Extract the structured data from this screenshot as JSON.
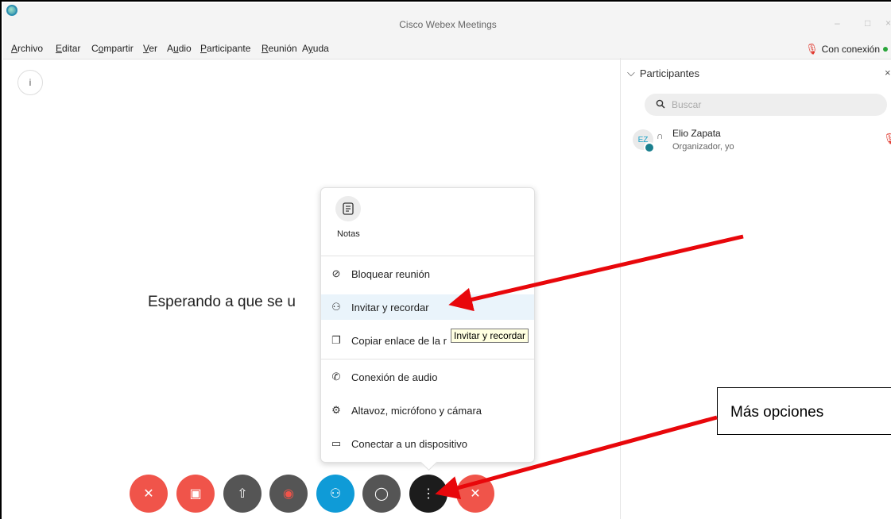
{
  "window": {
    "title": "Cisco Webex Meetings",
    "minimize": "–",
    "maximize": "□",
    "close": "×"
  },
  "menu": [
    "Archivo",
    "Editar",
    "Compartir",
    "Ver",
    "Audio",
    "Participante",
    "Reunión",
    "Ayuda"
  ],
  "connection": {
    "label": "Con conexión",
    "color": "#29a53a"
  },
  "info_icon": "i",
  "main": {
    "waiting_text": "Esperando a que se u"
  },
  "participants": {
    "header": "Participantes",
    "collapse_glyph": "⌵",
    "close_glyph": "×",
    "search_placeholder": "Buscar",
    "list": [
      {
        "initials": "EZ",
        "name": "Elio Zapata",
        "role": "Organizador, yo"
      }
    ]
  },
  "popup": {
    "notes_label": "Notas",
    "items": [
      {
        "icon": "lock-circle-icon",
        "glyph": "⊘",
        "label": "Bloquear reunión"
      },
      {
        "icon": "invite-person-icon",
        "glyph": "⚇",
        "label": "Invitar y recordar"
      },
      {
        "icon": "copy-icon",
        "glyph": "❐",
        "label": "Copiar enlace de la r"
      },
      {
        "icon": "phone-icon",
        "glyph": "✆",
        "label": "Conexión de audio"
      },
      {
        "icon": "gear-icon",
        "glyph": "⚙",
        "label": "Altavoz, micrófono y cámara"
      },
      {
        "icon": "cast-icon",
        "glyph": "▭",
        "label": "Conectar a un dispositivo"
      }
    ]
  },
  "tooltip": "Invitar y recordar",
  "controls": [
    {
      "name": "mute-button",
      "icon": "mic-off-icon",
      "glyph": "✕",
      "color": "#f0544a"
    },
    {
      "name": "video-button",
      "icon": "video-off-icon",
      "glyph": "▣",
      "color": "#f0544a"
    },
    {
      "name": "share-button",
      "icon": "share-icon",
      "glyph": "⇧",
      "color": "#555555"
    },
    {
      "name": "record-button",
      "icon": "record-icon",
      "glyph": "◉",
      "color": "#555555"
    },
    {
      "name": "participants-button",
      "icon": "participants-icon",
      "glyph": "⚇",
      "color": "#0f9bd7"
    },
    {
      "name": "chat-button",
      "icon": "chat-icon",
      "glyph": "◯",
      "color": "#555555"
    },
    {
      "name": "more-options-button",
      "icon": "more-icon",
      "glyph": "⋮",
      "color": "#1c1c1c"
    },
    {
      "name": "end-meeting-button",
      "icon": "close-icon",
      "glyph": "✕",
      "color": "#f0544a"
    }
  ],
  "annotation": {
    "callout_text": "Más opciones",
    "arrow_color": "#e8070b"
  }
}
